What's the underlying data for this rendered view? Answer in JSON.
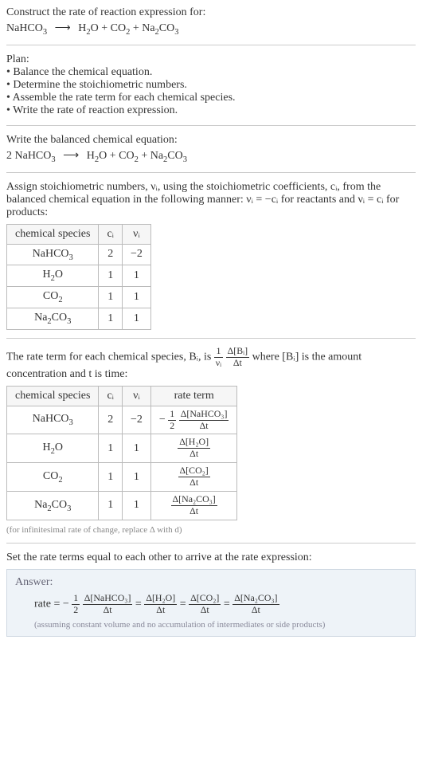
{
  "prompt_line1": "Construct the rate of reaction expression for:",
  "unbalanced": {
    "reactants": [
      "NaHCO₃"
    ],
    "products": [
      "H₂O",
      "CO₂",
      "Na₂CO₃"
    ]
  },
  "plan_heading": "Plan:",
  "plan_items": [
    "Balance the chemical equation.",
    "Determine the stoichiometric numbers.",
    "Assemble the rate term for each chemical species.",
    "Write the rate of reaction expression."
  ],
  "balanced_heading": "Write the balanced chemical equation:",
  "balanced": {
    "lhs": "2 NaHCO₃",
    "rhs": "H₂O + CO₂ + Na₂CO₃"
  },
  "stoich_text_a": "Assign stoichiometric numbers, νᵢ, using the stoichiometric coefficients, cᵢ, from the balanced chemical equation in the following manner: νᵢ = −cᵢ for reactants and νᵢ = cᵢ for products:",
  "table1": {
    "headers": [
      "chemical species",
      "cᵢ",
      "νᵢ"
    ],
    "rows": [
      [
        "NaHCO₃",
        "2",
        "−2"
      ],
      [
        "H₂O",
        "1",
        "1"
      ],
      [
        "CO₂",
        "1",
        "1"
      ],
      [
        "Na₂CO₃",
        "1",
        "1"
      ]
    ]
  },
  "rate_term_text_a": "The rate term for each chemical species, Bᵢ, is ",
  "rate_term_text_b": " where [Bᵢ] is the amount concentration and t is time:",
  "rate_term_frac_outer_num": "1",
  "rate_term_frac_outer_den": "νᵢ",
  "rate_term_frac_inner_num": "Δ[Bᵢ]",
  "rate_term_frac_inner_den": "Δt",
  "table2": {
    "headers": [
      "chemical species",
      "cᵢ",
      "νᵢ",
      "rate term"
    ],
    "rows": [
      {
        "species": "NaHCO₃",
        "c": "2",
        "nu": "−2",
        "term_prefix": "−",
        "coeff_num": "1",
        "coeff_den": "2",
        "conc_num": "Δ[NaHCO₃]",
        "conc_den": "Δt"
      },
      {
        "species": "H₂O",
        "c": "1",
        "nu": "1",
        "term_prefix": "",
        "coeff_num": "",
        "coeff_den": "",
        "conc_num": "Δ[H₂O]",
        "conc_den": "Δt"
      },
      {
        "species": "CO₂",
        "c": "1",
        "nu": "1",
        "term_prefix": "",
        "coeff_num": "",
        "coeff_den": "",
        "conc_num": "Δ[CO₂]",
        "conc_den": "Δt"
      },
      {
        "species": "Na₂CO₃",
        "c": "1",
        "nu": "1",
        "term_prefix": "",
        "coeff_num": "",
        "coeff_den": "",
        "conc_num": "Δ[Na₂CO₃]",
        "conc_den": "Δt"
      }
    ]
  },
  "infinitesimal_note": "(for infinitesimal rate of change, replace Δ with d)",
  "final_heading": "Set the rate terms equal to each other to arrive at the rate expression:",
  "answer_label": "Answer:",
  "answer_rate_label": "rate = −",
  "answer_terms": [
    {
      "coeff_num": "1",
      "coeff_den": "2",
      "conc_num": "Δ[NaHCO₃]",
      "conc_den": "Δt"
    },
    {
      "coeff_num": "",
      "coeff_den": "",
      "conc_num": "Δ[H₂O]",
      "conc_den": "Δt"
    },
    {
      "coeff_num": "",
      "coeff_den": "",
      "conc_num": "Δ[CO₂]",
      "conc_den": "Δt"
    },
    {
      "coeff_num": "",
      "coeff_den": "",
      "conc_num": "Δ[Na₂CO₃]",
      "conc_den": "Δt"
    }
  ],
  "answer_note": "(assuming constant volume and no accumulation of intermediates or side products)",
  "chart_data": {
    "type": "table",
    "title": "Stoichiometric numbers and rate terms for 2 NaHCO₃ → H₂O + CO₂ + Na₂CO₃",
    "columns": [
      "chemical species",
      "c_i",
      "ν_i",
      "rate term"
    ],
    "rows": [
      {
        "chemical species": "NaHCO3",
        "c_i": 2,
        "ν_i": -2,
        "rate term": "-(1/2) Δ[NaHCO3]/Δt"
      },
      {
        "chemical species": "H2O",
        "c_i": 1,
        "ν_i": 1,
        "rate term": "Δ[H2O]/Δt"
      },
      {
        "chemical species": "CO2",
        "c_i": 1,
        "ν_i": 1,
        "rate term": "Δ[CO2]/Δt"
      },
      {
        "chemical species": "Na2CO3",
        "c_i": 1,
        "ν_i": 1,
        "rate term": "Δ[Na2CO3]/Δt"
      }
    ],
    "rate_expression": "rate = -(1/2) Δ[NaHCO3]/Δt = Δ[H2O]/Δt = Δ[CO2]/Δt = Δ[Na2CO3]/Δt"
  }
}
